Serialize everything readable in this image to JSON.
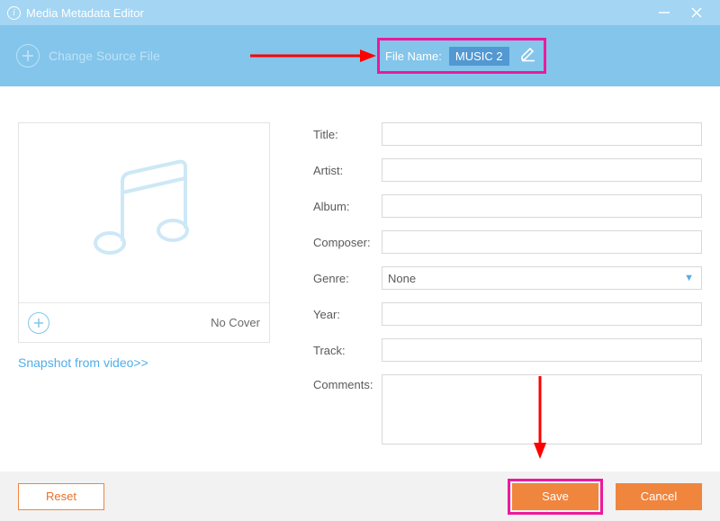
{
  "window": {
    "title": "Media Metadata Editor"
  },
  "toolbar": {
    "change_source": "Change Source File",
    "filename_label": "File Name:",
    "filename_value": "MUSIC 2"
  },
  "cover": {
    "nocover": "No Cover",
    "snapshot": "Snapshot from video>>"
  },
  "fields": {
    "title": {
      "label": "Title:",
      "value": ""
    },
    "artist": {
      "label": "Artist:",
      "value": ""
    },
    "album": {
      "label": "Album:",
      "value": ""
    },
    "composer": {
      "label": "Composer:",
      "value": ""
    },
    "genre": {
      "label": "Genre:",
      "selected": "None"
    },
    "year": {
      "label": "Year:",
      "value": ""
    },
    "track": {
      "label": "Track:",
      "value": ""
    },
    "comments": {
      "label": "Comments:",
      "value": ""
    }
  },
  "footer": {
    "reset": "Reset",
    "save": "Save",
    "cancel": "Cancel"
  }
}
